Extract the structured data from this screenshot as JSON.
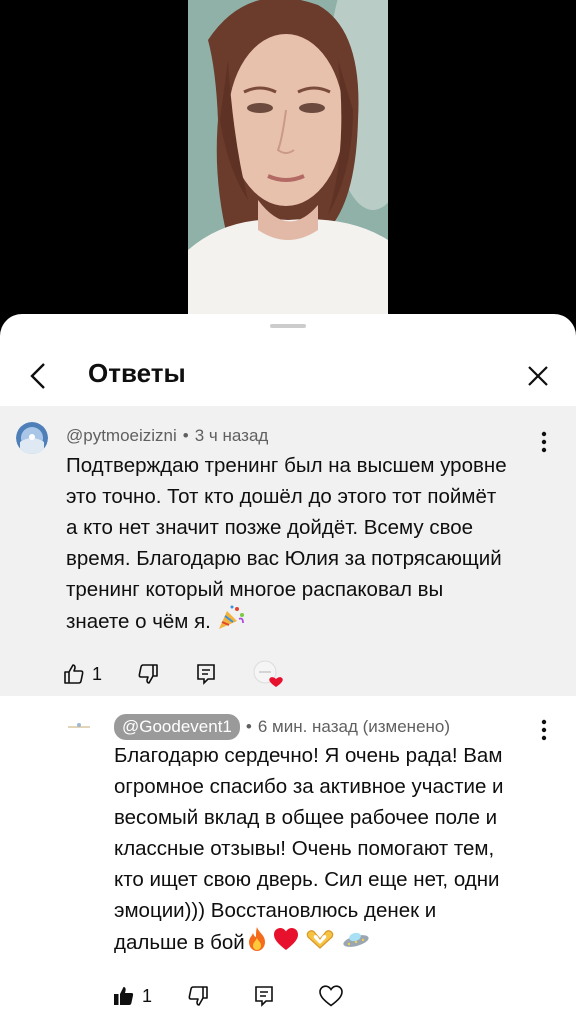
{
  "header": {
    "title": "Ответы"
  },
  "parent_comment": {
    "author": "@pytmoeizizni",
    "separator": "•",
    "time": "3 ч назад",
    "lines": [
      "Подтверждаю тренинг был на высшем уровне",
      "это точно. Тот кто дошёл до этого тот поймёт",
      "а кто нет значит позже дойдёт. Всему свое",
      "время. Благодарю вас Юлия за потрясающий",
      "тренинг который многое распаковал вы",
      "знаете о чём я."
    ],
    "like_count": "1",
    "icons": [
      "thumbs-up-icon",
      "thumbs-down-icon",
      "reply-icon",
      "creator-heart-icon",
      "party-popper-icon"
    ]
  },
  "reply_comment": {
    "author": "@Goodevent1",
    "separator": "•",
    "time": "6 мин. назад (изменено)",
    "lines": [
      "Благодарю сердечно! Я очень рада! Вам",
      "огромное спасибо за активное участие и",
      "весомый вклад в общее рабочее поле и",
      "классные отзывы! Очень помогают тем,",
      "кто ищет свою дверь. Сил еще нет, одни",
      "эмоции))) Восстановлюсь денек и",
      "дальше в бой"
    ],
    "like_count": "1",
    "icons": [
      "thumbs-up-filled-icon",
      "thumbs-down-icon",
      "reply-icon",
      "heart-outline-icon",
      "fire-icon",
      "red-heart-icon",
      "heart-hands-icon",
      "ufo-icon"
    ]
  },
  "colors": {
    "heart": "#e8112d",
    "handle_pill": "#9a9a9a",
    "parent_bg": "#f1f1f1",
    "meta_text": "#606060"
  }
}
